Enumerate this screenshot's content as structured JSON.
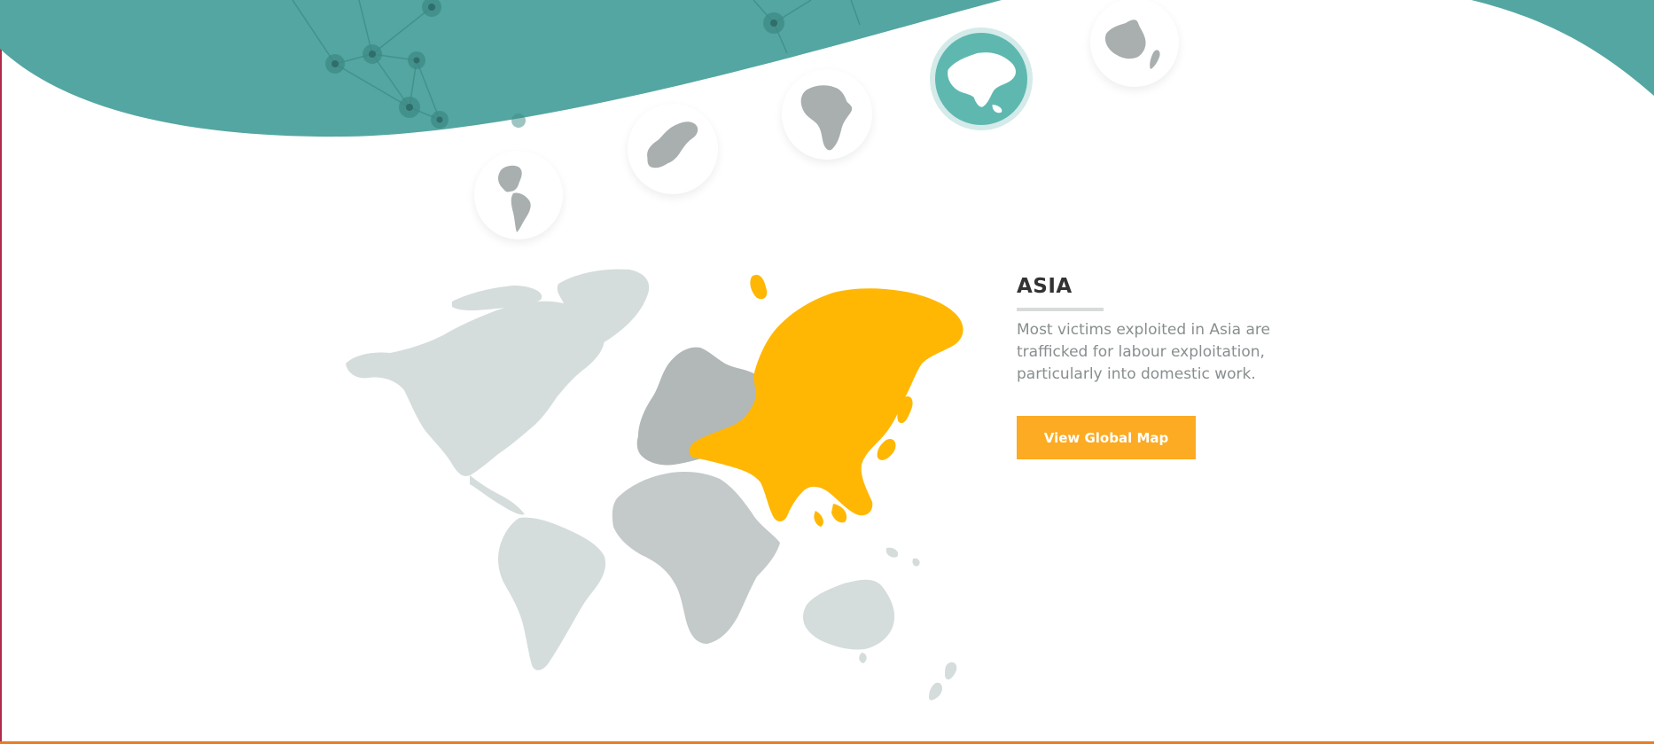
{
  "colors": {
    "teal": "#53a6a1",
    "active_bubble": "#5eb8b0",
    "highlight_region": "#ffb703",
    "europe_region": "#b2b7b8",
    "africa_region": "#c4c9c9",
    "americas_oceania_region": "#d5dcdc",
    "button": "#fcab22",
    "bottom_border": "#e67e22"
  },
  "region_selector": {
    "selected": "asia",
    "items": [
      {
        "id": "americas",
        "icon": "americas-globe-icon",
        "active": false
      },
      {
        "id": "europe",
        "icon": "europe-globe-icon",
        "active": false
      },
      {
        "id": "africa",
        "icon": "africa-globe-icon",
        "active": false
      },
      {
        "id": "asia",
        "icon": "asia-globe-icon",
        "active": true
      },
      {
        "id": "oceania",
        "icon": "oceania-globe-icon",
        "active": false
      }
    ]
  },
  "info": {
    "title": "ASIA",
    "description": "Most victims exploited in Asia are trafficked for labour exploitation, particularly into domestic work."
  },
  "buttons": {
    "view_global_map": "View Global Map"
  }
}
